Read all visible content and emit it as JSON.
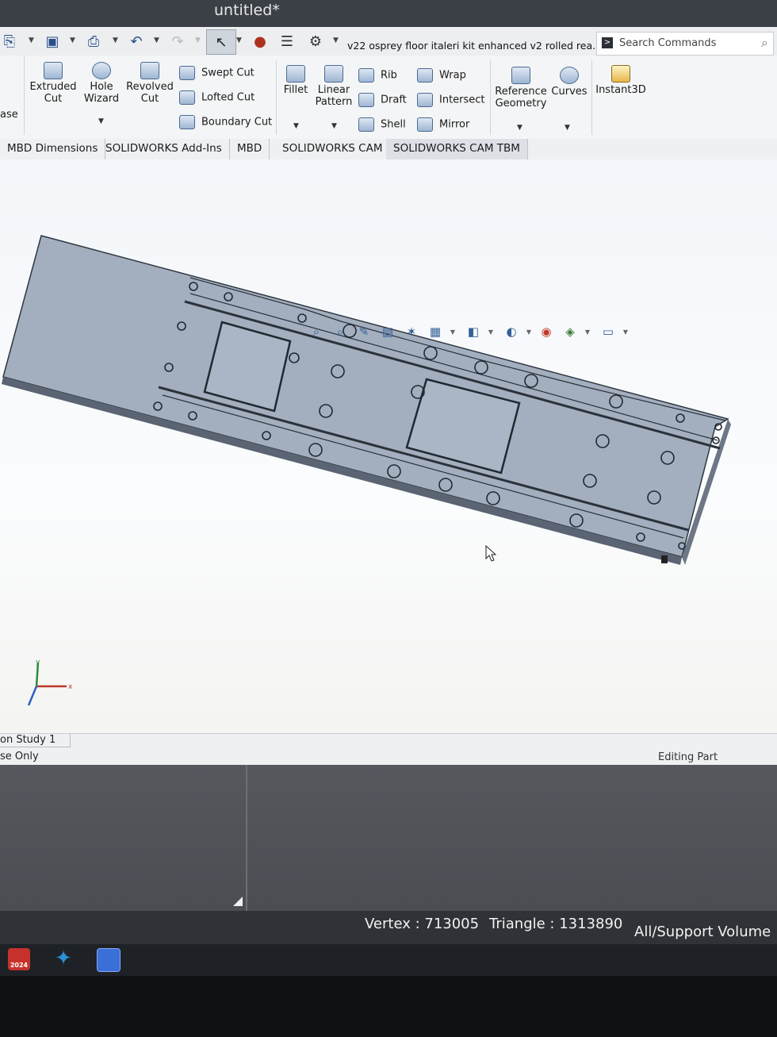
{
  "window": {
    "title": "untitled*"
  },
  "quick_access": {
    "document_name": "v22 osprey floor italeri kit enhanced v2 rolled rea..."
  },
  "search": {
    "placeholder": "Search Commands"
  },
  "ribbon": {
    "partial_left": "ase",
    "extruded_cut": [
      "Extruded",
      "Cut"
    ],
    "hole_wizard": [
      "Hole",
      "Wizard"
    ],
    "revolved_cut": [
      "Revolved",
      "Cut"
    ],
    "swept_cut": "Swept Cut",
    "lofted_cut": "Lofted Cut",
    "boundary_cut": "Boundary Cut",
    "fillet": "Fillet",
    "linear_pattern": [
      "Linear",
      "Pattern"
    ],
    "rib": "Rib",
    "draft": "Draft",
    "shell": "Shell",
    "wrap": "Wrap",
    "intersect": "Intersect",
    "mirror": "Mirror",
    "reference_geometry": [
      "Reference",
      "Geometry"
    ],
    "curves": "Curves",
    "instant3d": "Instant3D"
  },
  "tabs": [
    "MBD Dimensions",
    "SOLIDWORKS Add-Ins",
    "MBD",
    "SOLIDWORKS CAM",
    "SOLIDWORKS CAM TBM"
  ],
  "lower_panel": {
    "study_tab": "on Study 1",
    "mode_text": "se Only",
    "editing": "Editing Part"
  },
  "status_bar": {
    "vertex": "Vertex : 713005",
    "triangle": "Triangle : 1313890",
    "volume": "All/Support Volume"
  },
  "triad_axis": {
    "x": "x",
    "y": "y"
  },
  "taskbar": {
    "sw_label": "2024"
  },
  "colors": {
    "titlebar": "#3b4046",
    "ribbon": "#f4f5f6",
    "viewport": "#f6f8fb",
    "part_face": "#a2aebd",
    "status_bar": "#2f3337"
  }
}
